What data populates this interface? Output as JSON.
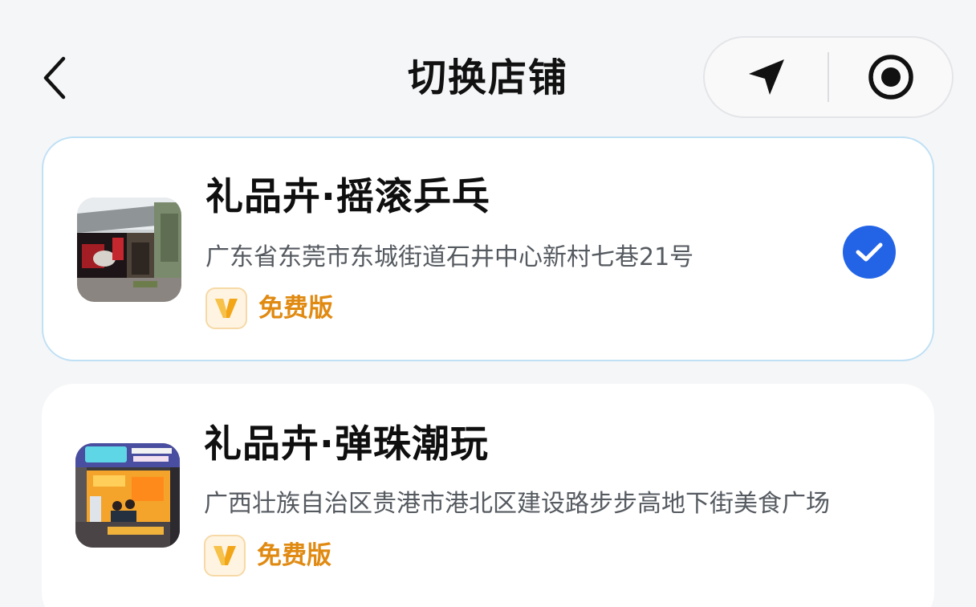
{
  "header": {
    "title": "切换店铺",
    "back_icon": "chevron-left-icon",
    "capsule": {
      "locate_icon": "navigation-arrow-icon",
      "record_icon": "target-circle-icon"
    }
  },
  "stores": [
    {
      "name": "礼品卉·摇滚乒乓",
      "address": "广东省东莞市东城街道石井中心新村七巷21号",
      "plan": "免费版",
      "plan_icon": "v-badge-icon",
      "selected": true
    },
    {
      "name": "礼品卉·弹珠潮玩",
      "address": "广西壮族自治区贵港市港北区建设路步步高地下街美食广场",
      "plan": "免费版",
      "plan_icon": "v-badge-icon",
      "selected": false
    }
  ],
  "colors": {
    "background": "#f5f6f8",
    "accent_blue": "#2364e6",
    "selected_border": "#bfe0f5",
    "plan_orange": "#e08a12"
  }
}
